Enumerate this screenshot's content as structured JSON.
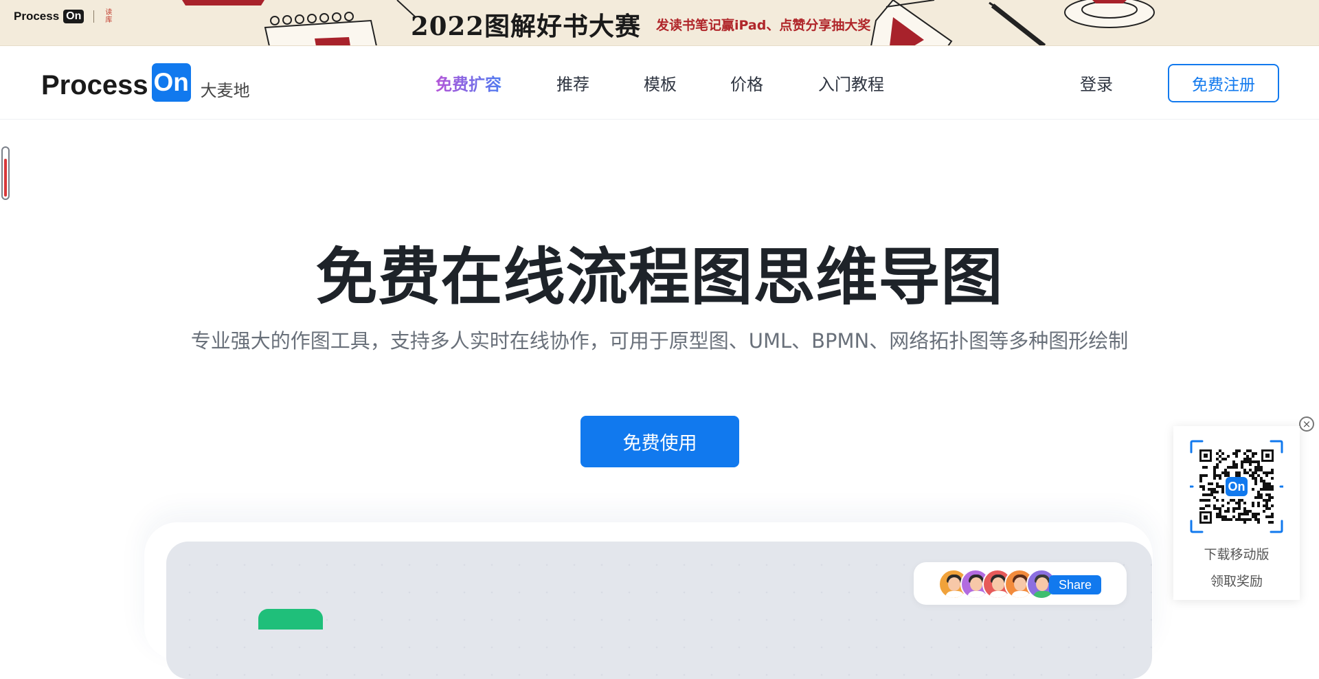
{
  "banner": {
    "logo_word": "Process",
    "logo_on": "On",
    "seal_text": "读库",
    "title": "2022图解好书大赛",
    "subtitle": "发读书笔记赢iPad、点赞分享抽大奖"
  },
  "nav": {
    "logo_word": "Process",
    "logo_on": "On",
    "site_name": "大麦地",
    "links": [
      "免费扩容",
      "推荐",
      "模板",
      "价格",
      "入门教程"
    ],
    "login": "登录",
    "register": "免费注册"
  },
  "hero": {
    "title": "免费在线流程图思维导图",
    "subtitle": "专业强大的作图工具，支持多人实时在线协作，可用于原型图、UML、BPMN、网络拓扑图等多种图形绘制",
    "cta": "免费使用"
  },
  "preview": {
    "share_label": "Share",
    "avatar_colors": [
      "#f0a23b",
      "#b26be0",
      "#e65a5a",
      "#f28b3c",
      "#8b6fe0"
    ]
  },
  "qr_widget": {
    "logo": "On",
    "line1": "下载移动版",
    "line2": "领取奖励",
    "close_icon": "close-icon"
  },
  "colors": {
    "accent": "#1179ee",
    "banner_bg": "#f3ebdb",
    "banner_red": "#b0262a"
  }
}
